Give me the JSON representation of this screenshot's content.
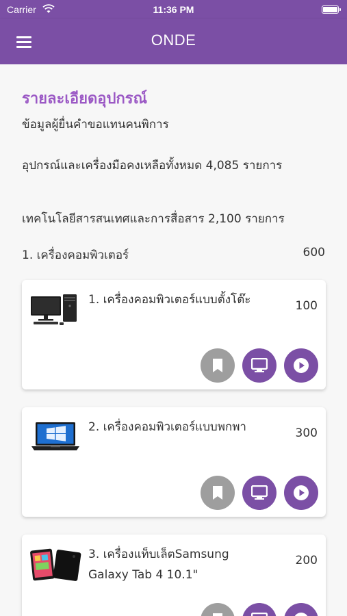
{
  "status_bar": {
    "carrier": "Carrier",
    "time": "11:36 PM"
  },
  "app_bar": {
    "title": "ONDE"
  },
  "page": {
    "heading": "รายละเอียดอุปกรณ์",
    "subtitle": "ข้อมูลผู้ยื่นคำขอแทนคนพิการ",
    "total_line": "อุปกรณ์และเครื่องมือคงเหลือทั้งหมด 4,085 รายการ",
    "ict_line": "เทคโนโลยีสารสนเทศและการสื่อสาร 2,100 รายการ",
    "category": {
      "label": "1. เครื่องคอมพิวเตอร์",
      "count": "600"
    }
  },
  "items": [
    {
      "name": "1. เครื่องคอมพิวเตอร์แบบตั้งโต๊ะ",
      "count": "100",
      "image": "desktop-computer"
    },
    {
      "name": "2. เครื่องคอมพิวเตอร์แบบพกพา",
      "count": "300",
      "image": "laptop"
    },
    {
      "name": "3. เครื่องแท็บเล็ตSamsung Galaxy Tab 4 10.1\"",
      "count": "200",
      "image": "tablet"
    }
  ],
  "icons": {
    "bookmark": "bookmark-icon",
    "monitor": "monitor-icon",
    "play": "play-icon",
    "menu": "menu-icon",
    "wifi": "wifi-icon",
    "battery": "battery-icon"
  },
  "colors": {
    "primary": "#7b4fa5",
    "heading": "#9b59c5",
    "bookmark_button": "#9e9e9e",
    "background": "#f7f7f7"
  }
}
